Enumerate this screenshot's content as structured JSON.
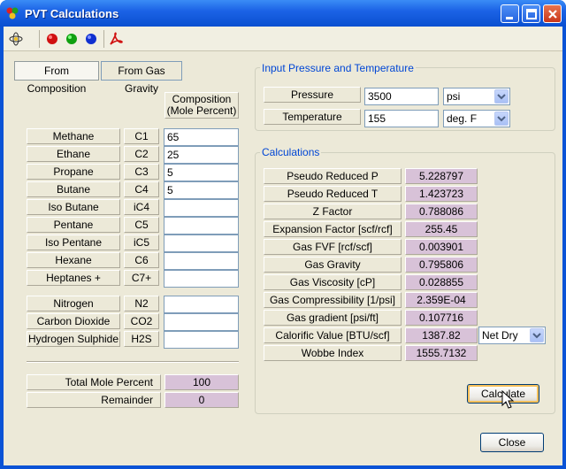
{
  "window": {
    "title": "PVT Calculations"
  },
  "tabs": [
    {
      "label": "From Composition",
      "active": true
    },
    {
      "label": "From Gas Gravity",
      "active": false
    }
  ],
  "composition": {
    "header_line1": "Composition",
    "header_line2": "(Mole Percent)",
    "components": [
      {
        "name": "Methane",
        "formula": "C1",
        "value": "65"
      },
      {
        "name": "Ethane",
        "formula": "C2",
        "value": "25"
      },
      {
        "name": "Propane",
        "formula": "C3",
        "value": "5"
      },
      {
        "name": "Butane",
        "formula": "C4",
        "value": "5"
      },
      {
        "name": "Iso Butane",
        "formula": "iC4",
        "value": ""
      },
      {
        "name": "Pentane",
        "formula": "C5",
        "value": ""
      },
      {
        "name": "Iso Pentane",
        "formula": "iC5",
        "value": ""
      },
      {
        "name": "Hexane",
        "formula": "C6",
        "value": ""
      },
      {
        "name": "Heptanes +",
        "formula": "C7+",
        "value": ""
      }
    ],
    "non_hydrocarbons": [
      {
        "name": "Nitrogen",
        "formula": "N2",
        "value": ""
      },
      {
        "name": "Carbon Dioxide",
        "formula": "CO2",
        "value": ""
      },
      {
        "name": "Hydrogen Sulphide",
        "formula": "H2S",
        "value": ""
      }
    ],
    "totals": [
      {
        "label": "Total Mole Percent",
        "value": "100"
      },
      {
        "label": "Remainder",
        "value": "0"
      }
    ]
  },
  "input_group": {
    "title": "Input Pressure and Temperature",
    "pressure": {
      "label": "Pressure",
      "value": "3500",
      "unit": "psi"
    },
    "temperature": {
      "label": "Temperature",
      "value": "155",
      "unit": "deg. F"
    }
  },
  "calc_group": {
    "title": "Calculations",
    "rows": [
      {
        "label": "Pseudo Reduced P",
        "value": "5.228797"
      },
      {
        "label": "Pseudo Reduced T",
        "value": "1.423723"
      },
      {
        "label": "Z Factor",
        "value": "0.788086"
      },
      {
        "label": "Expansion Factor [scf/rcf]",
        "value": "255.45"
      },
      {
        "label": "Gas FVF [rcf/scf]",
        "value": "0.003901"
      },
      {
        "label": "Gas Gravity",
        "value": "0.795806"
      },
      {
        "label": "Gas Viscosity [cP]",
        "value": "0.028855"
      },
      {
        "label": "Gas Compressibility [1/psi]",
        "value": "2.359E-04"
      },
      {
        "label": "Gas gradient [psi/ft]",
        "value": "0.107716"
      },
      {
        "label": "Calorific Value [BTU/scf]",
        "value": "1387.82"
      },
      {
        "label": "Wobbe Index",
        "value": "1555.7132"
      }
    ],
    "calorific_mode": "Net Dry",
    "calculate_label": "Calculate"
  },
  "close_label": "Close",
  "icons": [
    "app-icon",
    "atom-dropdown-icon",
    "red-sphere-icon",
    "green-sphere-icon",
    "blue-sphere-icon",
    "pdf-icon",
    "cursor-icon"
  ],
  "colors": {
    "output_bg": "#d8c2d8",
    "group_title": "#0046d5",
    "titlebar": "#0a4fd0"
  }
}
